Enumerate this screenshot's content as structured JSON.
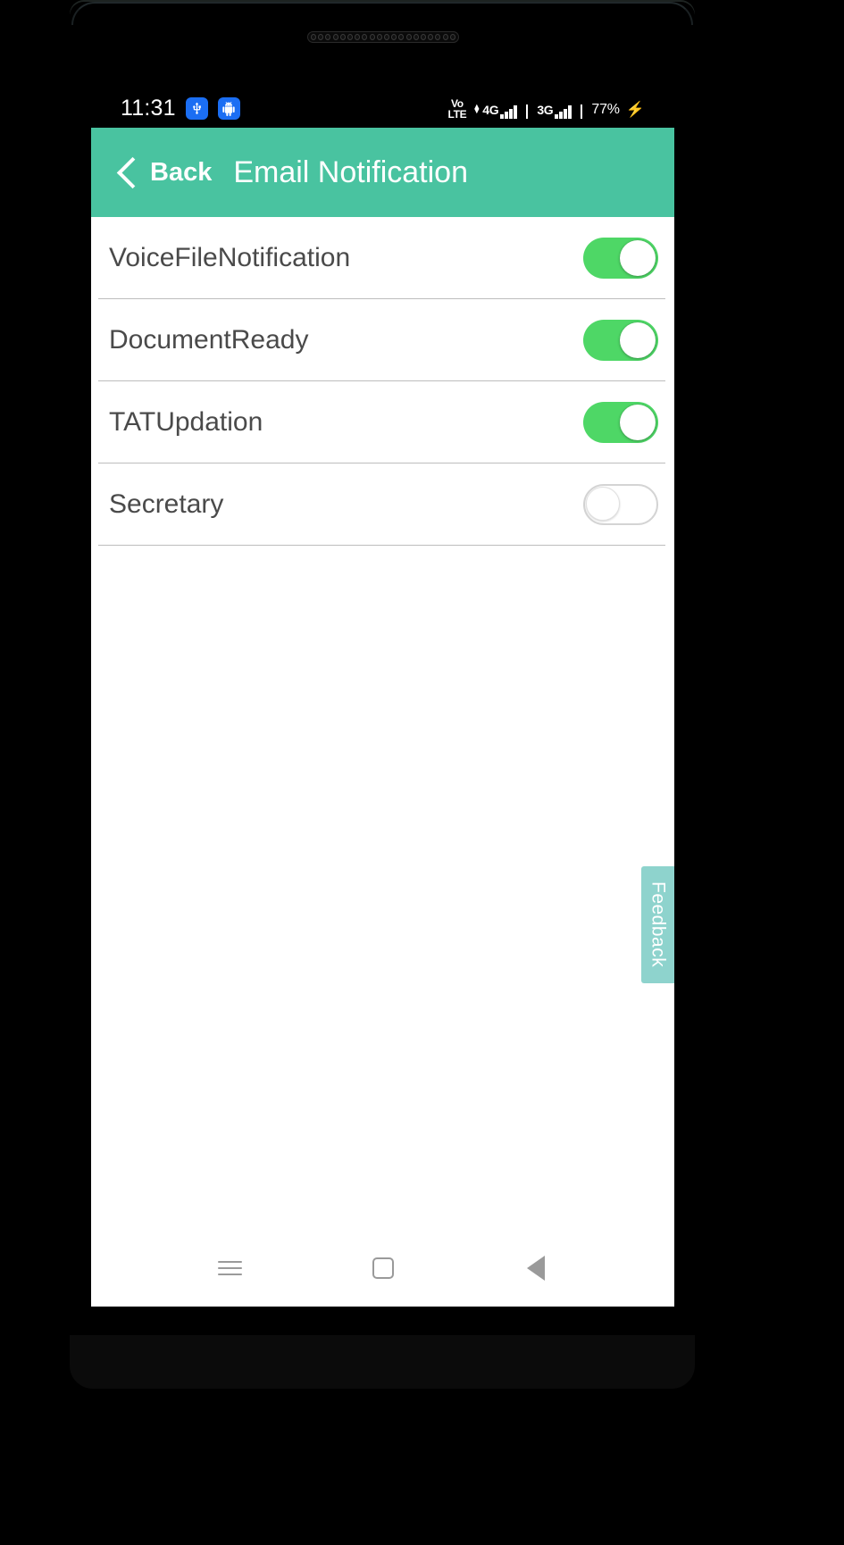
{
  "status_bar": {
    "clock": "11:31",
    "icons": [
      "usb-icon",
      "android-robot-icon"
    ],
    "volte_top": "Vo",
    "volte_bottom": "LTE",
    "sim1_network": "4G",
    "sim2_network": "3G",
    "battery": "77%",
    "charging_glyph": "⚡"
  },
  "header": {
    "back_label": "Back",
    "title": "Email Notification",
    "background_color": "#49c3a0"
  },
  "settings": {
    "rows": [
      {
        "label": "VoiceFileNotification",
        "state": "on"
      },
      {
        "label": "DocumentReady",
        "state": "on"
      },
      {
        "label": "TATUpdation",
        "state": "on"
      },
      {
        "label": "Secretary",
        "state": "off"
      }
    ],
    "switch_on_color": "#4ed766",
    "switch_off_color": "#d4d4d4",
    "label_color": "#4a4a4a"
  },
  "feedback_tab": {
    "label": "Feedback",
    "background_color": "#8ed3cd"
  },
  "nav_bar": {
    "menu_label": "Menu",
    "home_label": "Home",
    "back_label": "Back"
  }
}
